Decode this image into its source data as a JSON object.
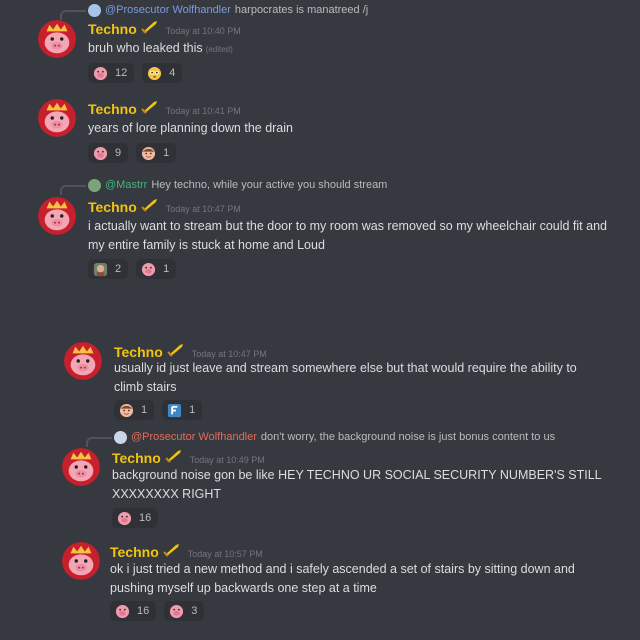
{
  "messages": [
    {
      "reply": {
        "author": "@Prosecutor Wolfhandler",
        "text": "harpocrates is manatreed /j",
        "color": "#7a9be0"
      },
      "author": "Techno",
      "time": "Today at 10:40 PM",
      "text": "bruh who leaked this",
      "edited": "(edited)",
      "reactions": [
        {
          "icon": "pig-emoji-icon",
          "count": "12"
        },
        {
          "icon": "flushed-face-icon",
          "count": "4"
        }
      ]
    },
    {
      "author": "Techno",
      "time": "Today at 10:41 PM",
      "text": "years of lore planning down the drain",
      "reactions": [
        {
          "icon": "pig-emoji-icon",
          "count": "9"
        },
        {
          "icon": "face-emoji-icon",
          "count": "1"
        }
      ]
    },
    {
      "reply": {
        "author": "@Mastrr",
        "text": "Hey techno, while your active you should stream",
        "color": "#43b581"
      },
      "author": "Techno",
      "time": "Today at 10:47 PM",
      "text": "i actually want to stream but the door to my room was removed so my wheelchair could fit and my entire family is stuck at home and Loud",
      "reactions": [
        {
          "icon": "custom-emoji-icon",
          "count": "2"
        },
        {
          "icon": "pig-emoji-icon",
          "count": "1"
        }
      ]
    },
    {
      "author": "Techno",
      "time": "Today at 10:47 PM",
      "text": "usually id just leave and stream somewhere else but that would require the ability to climb stairs",
      "reactions": [
        {
          "icon": "face-emoji-icon",
          "count": "1"
        },
        {
          "icon": "f-letter-icon",
          "count": "1"
        }
      ]
    },
    {
      "reply": {
        "author": "@Prosecutor Wolfhandler",
        "text": "don't worry, the background noise is just bonus content to us",
        "color": "#e36c5b"
      },
      "author": "Techno",
      "time": "Today at 10:49 PM",
      "text": "background noise gon be like HEY TECHNO UR SOCIAL SECURITY NUMBER'S STILL XXXXXXXX RIGHT",
      "reactions": [
        {
          "icon": "pig-emoji-icon",
          "count": "16"
        }
      ]
    },
    {
      "author": "Techno",
      "time": "Today at 10:57 PM",
      "text": "ok i just tried a new method and i safely ascended a set of stairs by sitting down and pushing myself up backwards one step at a time",
      "reactions": [
        {
          "icon": "pig-emoji-icon",
          "count": "16"
        },
        {
          "icon": "pig-emoji-icon",
          "count": "3"
        }
      ]
    }
  ],
  "colors": {
    "background": "#36393f",
    "username": "#f1c40f",
    "text": "#dcddde",
    "muted": "#72767d"
  }
}
